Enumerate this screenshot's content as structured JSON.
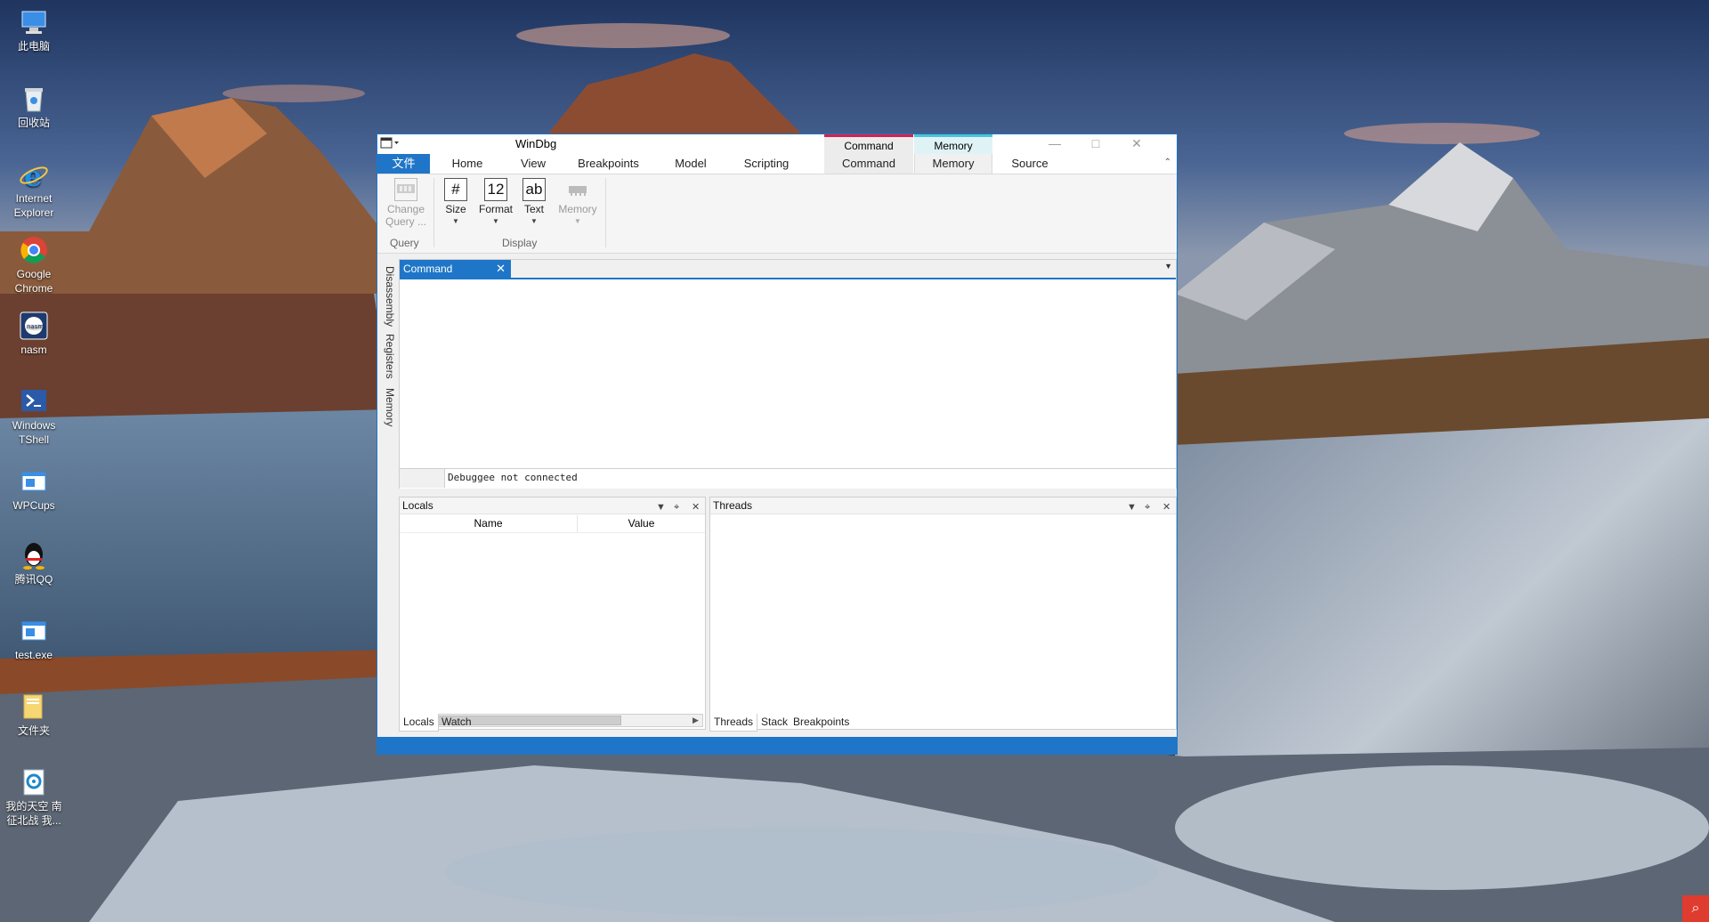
{
  "desktop": {
    "icons": [
      {
        "icon": "computer-icon",
        "label": "此电脑"
      },
      {
        "icon": "recycle-bin-icon",
        "label": "回收站"
      },
      {
        "icon": "internet-explorer-icon",
        "label": "Internet Explorer"
      },
      {
        "icon": "chrome-icon",
        "label": "Google Chrome"
      },
      {
        "icon": "nasm-icon",
        "label": "nasm"
      },
      {
        "icon": "powershell-icon",
        "label": "Windows TShell"
      },
      {
        "icon": "app-icon",
        "label": "WPCups"
      },
      {
        "icon": "qq-icon",
        "label": "腾讯QQ"
      },
      {
        "icon": "app-icon",
        "label": "test.exe"
      },
      {
        "icon": "folder-icon",
        "label": "文件夹"
      },
      {
        "icon": "game-icon",
        "label": "我的天空 南征北战  我..."
      }
    ]
  },
  "window": {
    "title": "WinDbg",
    "context_groups": {
      "command": "Command",
      "memory": "Memory"
    },
    "tabs": [
      "文件",
      "Home",
      "View",
      "Breakpoints",
      "Model",
      "Scripting",
      "Command",
      "Memory",
      "Source"
    ],
    "active_tab": "Memory",
    "ribbon": {
      "change_query": "Change Query ...",
      "size": "Size",
      "size_icon": "#",
      "format": "Format",
      "format_icon": "12",
      "text": "Text",
      "text_icon": "ab",
      "memory": "Memory",
      "group_query": "Query",
      "group_display": "Display"
    },
    "side_tabs": [
      "Disassembly",
      "Registers",
      "Memory"
    ],
    "command_pane": {
      "tab_label": "Command",
      "status": "Debuggee not connected"
    },
    "locals_pane": {
      "title": "Locals",
      "columns": [
        "Name",
        "Value"
      ],
      "bottom_tabs": [
        "Locals",
        "Watch"
      ]
    },
    "threads_pane": {
      "title": "Threads",
      "bottom_tabs": [
        "Threads",
        "Stack",
        "Breakpoints"
      ]
    }
  },
  "colors": {
    "accent": "#1f76c8",
    "command_context": "#d8204c",
    "memory_context": "#4fc3d4"
  }
}
